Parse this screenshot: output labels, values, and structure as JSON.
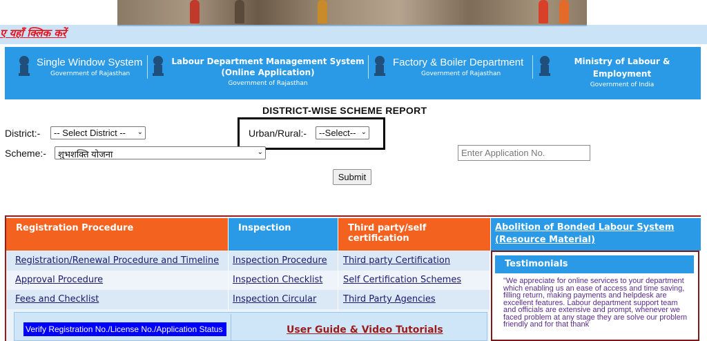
{
  "top": {
    "hindi_link": "ए यहाँ क्लिक करें"
  },
  "header": {
    "cells": [
      {
        "title": "Single Window System",
        "subtitle": "Government of Rajasthan"
      },
      {
        "title_line1": "Labour Department Management System",
        "title_line2": "(Online Application)",
        "subtitle": "Government of Rajasthan"
      },
      {
        "title": "Factory & Boiler Department",
        "subtitle": "Government of Rajasthan"
      },
      {
        "title_line1": "Ministry of Labour &",
        "title_line2": "Employment",
        "subtitle": "Government of India"
      }
    ]
  },
  "report": {
    "title": "DISTRICT-WISE SCHEME REPORT",
    "district_label": "District:-",
    "district_value": "-- Select District --",
    "urban_rural_label": "Urban/Rural:-",
    "urban_rural_value": "--Select--",
    "scheme_label": "Scheme:-",
    "scheme_value": "शुभशक्ति योजना",
    "application_placeholder": "Enter Application No.",
    "submit_label": "Submit"
  },
  "links_table": {
    "headers": [
      "Registration Procedure",
      "Inspection",
      "Third party/self certification"
    ],
    "bonded_labour_line1": "Abolition of Bonded Labour System",
    "bonded_labour_line2": "(Resource Material)",
    "rows": [
      [
        "Registration/Renewal Procedure and Timeline",
        "Inspection Procedure",
        "Third party Certification"
      ],
      [
        "Approval Procedure",
        "Inspection Checklist",
        "Self Certification Schemes"
      ],
      [
        "Fees and Checklist",
        "Inspection Circular",
        "Third Party Agencies"
      ]
    ]
  },
  "testimonials": {
    "heading": "Testimonials",
    "text": "\"We appreciate for online services to your department which enabling us an ease of access and time saving, filling return, making payments and helpdesk are excellent features. Labour department support team and officials are extensive and prompt, whenever we faced problem at any stage they are solve our problem friendly and for that thank"
  },
  "guide": {
    "verify_label": "Verify Registration No./License No./Application Status",
    "user_guide_label": "User Guide & Video Tutorials"
  },
  "colors": {
    "header_blue": "#2a9ae6",
    "orange": "#f4621f",
    "maroon": "#9b1b1b",
    "verify_blue": "#0000ff"
  }
}
